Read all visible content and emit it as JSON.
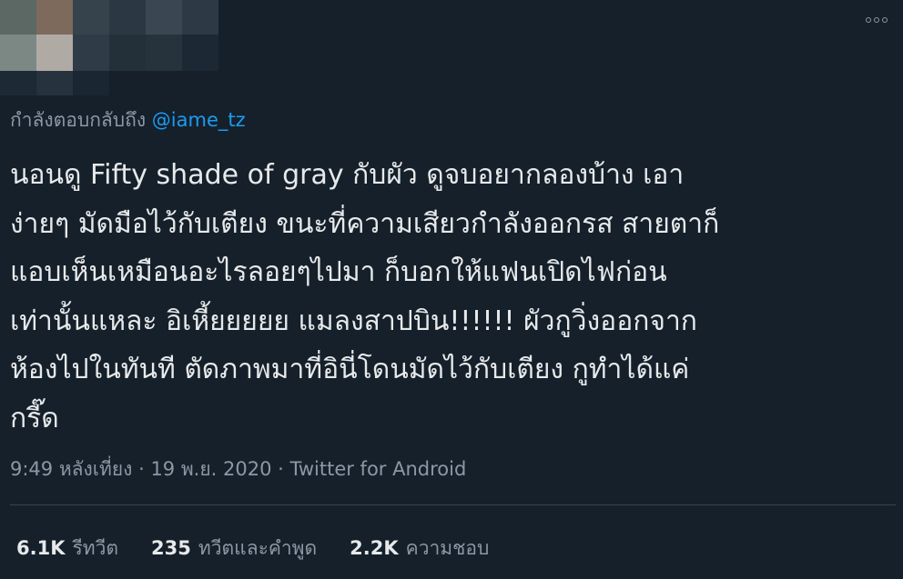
{
  "colors": {
    "background": "#15202b",
    "text_primary": "#e7e9ea",
    "text_secondary": "#8b98a5",
    "link": "#1d9bf0",
    "divider": "#38444d"
  },
  "header": {
    "more_icon": "more-horizontal-icon"
  },
  "reply_context": {
    "prefix": "กำลังตอบกลับถึง",
    "handle": "@iame_tz"
  },
  "tweet": {
    "lines": [
      "นอนดู Fifty shade of gray กับผัว ดูจบอยากลองบ้าง เอา",
      "ง่ายๆ มัดมือไว้กับเตียง ขนะที่ความเสียวกำลังออกรส สายตาก็",
      "แอบเห็นเหมือนอะไรลอยๆไปมา ก็บอกให้แฟนเปิดไฟก่อน",
      "เท่านั้นแหละ อิเหี้ยยยยย แมลงสาปบิน!!!!!! ผัวกูวิ่งออกจาก",
      "ห้องไปในทันที ตัดภาพมาที่อินี่โดนมัดไว้กับเตียง กูทำได้แค่",
      "กรี๊ด"
    ]
  },
  "meta": {
    "time": "9:49 หลังเที่ยง",
    "separator": "·",
    "date": "19 พ.ย. 2020",
    "source": "Twitter for Android"
  },
  "stats": {
    "retweets": {
      "count": "6.1K",
      "label": "รีทวีต"
    },
    "quotes": {
      "count": "235",
      "label": "ทวีตและคำพูด"
    },
    "likes": {
      "count": "2.2K",
      "label": "ความชอบ"
    }
  }
}
